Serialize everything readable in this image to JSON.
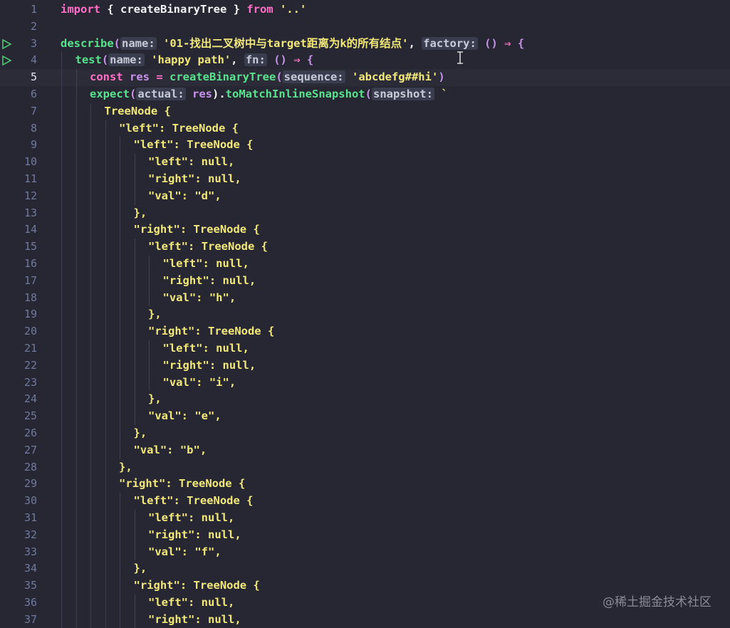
{
  "editor": {
    "language": "typescript",
    "current_line": 5,
    "lines": [
      {
        "n": "1",
        "indent": 0,
        "tokens": [
          {
            "t": "import",
            "c": "t-pink"
          },
          {
            "t": " { ",
            "c": "t-white"
          },
          {
            "t": "createBinaryTree",
            "c": "t-white"
          },
          {
            "t": " } ",
            "c": "t-white"
          },
          {
            "t": "from",
            "c": "t-pink"
          },
          {
            "t": " '..'",
            "c": "t-yellow"
          }
        ]
      },
      {
        "n": "2",
        "indent": 0,
        "tokens": []
      },
      {
        "n": "3",
        "indent": 0,
        "run": true,
        "tokens": [
          {
            "t": "describe",
            "c": "t-green"
          },
          {
            "t": "(",
            "c": "t-paren"
          },
          {
            "t": "name:",
            "c": "hint"
          },
          {
            "t": " '01-找出二叉树中与target距离为k的所有结点'",
            "c": "t-yellow"
          },
          {
            "t": ", ",
            "c": "t-white"
          },
          {
            "t": "factory:",
            "c": "hint"
          },
          {
            "t": " ",
            "c": "t-white"
          },
          {
            "t": "()",
            "c": "t-paren"
          },
          {
            "t": " ⇒ ",
            "c": "t-arrow"
          },
          {
            "t": "{",
            "c": "t-brace2"
          }
        ]
      },
      {
        "n": "4",
        "indent": 1,
        "run": true,
        "tokens": [
          {
            "t": "test",
            "c": "t-green"
          },
          {
            "t": "(",
            "c": "t-paren"
          },
          {
            "t": "name:",
            "c": "hint"
          },
          {
            "t": " 'happy path'",
            "c": "t-yellow"
          },
          {
            "t": ", ",
            "c": "t-white"
          },
          {
            "t": "fn:",
            "c": "hint"
          },
          {
            "t": " ",
            "c": "t-white"
          },
          {
            "t": "()",
            "c": "t-paren"
          },
          {
            "t": " ⇒ ",
            "c": "t-arrow"
          },
          {
            "t": "{",
            "c": "t-brace2"
          }
        ]
      },
      {
        "n": "5",
        "indent": 2,
        "tokens": [
          {
            "t": "const",
            "c": "t-pink"
          },
          {
            "t": " res",
            "c": "t-purple"
          },
          {
            "t": " = ",
            "c": "t-pink"
          },
          {
            "t": "createBinaryTree",
            "c": "t-green"
          },
          {
            "t": "(",
            "c": "t-paren"
          },
          {
            "t": "sequence:",
            "c": "hint"
          },
          {
            "t": " 'abcdefg##hi'",
            "c": "t-yellow"
          },
          {
            "t": ")",
            "c": "t-paren"
          }
        ]
      },
      {
        "n": "6",
        "indent": 2,
        "tokens": [
          {
            "t": "expect",
            "c": "t-green"
          },
          {
            "t": "(",
            "c": "t-paren"
          },
          {
            "t": "actual:",
            "c": "hint"
          },
          {
            "t": " res",
            "c": "t-purple"
          },
          {
            "t": ").",
            "c": "t-white"
          },
          {
            "t": "toMatchInlineSnapshot",
            "c": "t-green"
          },
          {
            "t": "(",
            "c": "t-paren"
          },
          {
            "t": "snapshot:",
            "c": "hint"
          },
          {
            "t": " `",
            "c": "t-yellow"
          }
        ]
      },
      {
        "n": "7",
        "indent": 3,
        "tokens": [
          {
            "t": "TreeNode {",
            "c": "t-yellow"
          }
        ]
      },
      {
        "n": "8",
        "indent": 4,
        "tokens": [
          {
            "t": "\"left\": TreeNode {",
            "c": "t-yellow"
          }
        ]
      },
      {
        "n": "9",
        "indent": 5,
        "tokens": [
          {
            "t": "\"left\": TreeNode {",
            "c": "t-yellow"
          }
        ]
      },
      {
        "n": "10",
        "indent": 6,
        "tokens": [
          {
            "t": "\"left\": null,",
            "c": "t-yellow"
          }
        ]
      },
      {
        "n": "11",
        "indent": 6,
        "tokens": [
          {
            "t": "\"right\": null,",
            "c": "t-yellow"
          }
        ]
      },
      {
        "n": "12",
        "indent": 6,
        "tokens": [
          {
            "t": "\"val\": \"d\",",
            "c": "t-yellow"
          }
        ]
      },
      {
        "n": "13",
        "indent": 5,
        "tokens": [
          {
            "t": "},",
            "c": "t-yellow"
          }
        ]
      },
      {
        "n": "14",
        "indent": 5,
        "tokens": [
          {
            "t": "\"right\": TreeNode {",
            "c": "t-yellow"
          }
        ]
      },
      {
        "n": "15",
        "indent": 6,
        "tokens": [
          {
            "t": "\"left\": TreeNode {",
            "c": "t-yellow"
          }
        ]
      },
      {
        "n": "16",
        "indent": 7,
        "tokens": [
          {
            "t": "\"left\": null,",
            "c": "t-yellow"
          }
        ]
      },
      {
        "n": "17",
        "indent": 7,
        "tokens": [
          {
            "t": "\"right\": null,",
            "c": "t-yellow"
          }
        ]
      },
      {
        "n": "18",
        "indent": 7,
        "tokens": [
          {
            "t": "\"val\": \"h\",",
            "c": "t-yellow"
          }
        ]
      },
      {
        "n": "19",
        "indent": 6,
        "tokens": [
          {
            "t": "},",
            "c": "t-yellow"
          }
        ]
      },
      {
        "n": "20",
        "indent": 6,
        "tokens": [
          {
            "t": "\"right\": TreeNode {",
            "c": "t-yellow"
          }
        ]
      },
      {
        "n": "21",
        "indent": 7,
        "tokens": [
          {
            "t": "\"left\": null,",
            "c": "t-yellow"
          }
        ]
      },
      {
        "n": "22",
        "indent": 7,
        "tokens": [
          {
            "t": "\"right\": null,",
            "c": "t-yellow"
          }
        ]
      },
      {
        "n": "23",
        "indent": 7,
        "tokens": [
          {
            "t": "\"val\": \"i\",",
            "c": "t-yellow"
          }
        ]
      },
      {
        "n": "24",
        "indent": 6,
        "tokens": [
          {
            "t": "},",
            "c": "t-yellow"
          }
        ]
      },
      {
        "n": "25",
        "indent": 6,
        "tokens": [
          {
            "t": "\"val\": \"e\",",
            "c": "t-yellow"
          }
        ]
      },
      {
        "n": "26",
        "indent": 5,
        "tokens": [
          {
            "t": "},",
            "c": "t-yellow"
          }
        ]
      },
      {
        "n": "27",
        "indent": 5,
        "tokens": [
          {
            "t": "\"val\": \"b\",",
            "c": "t-yellow"
          }
        ]
      },
      {
        "n": "28",
        "indent": 4,
        "tokens": [
          {
            "t": "},",
            "c": "t-yellow"
          }
        ]
      },
      {
        "n": "29",
        "indent": 4,
        "tokens": [
          {
            "t": "\"right\": TreeNode {",
            "c": "t-yellow"
          }
        ]
      },
      {
        "n": "30",
        "indent": 5,
        "tokens": [
          {
            "t": "\"left\": TreeNode {",
            "c": "t-yellow"
          }
        ]
      },
      {
        "n": "31",
        "indent": 6,
        "tokens": [
          {
            "t": "\"left\": null,",
            "c": "t-yellow"
          }
        ]
      },
      {
        "n": "32",
        "indent": 6,
        "tokens": [
          {
            "t": "\"right\": null,",
            "c": "t-yellow"
          }
        ]
      },
      {
        "n": "33",
        "indent": 6,
        "tokens": [
          {
            "t": "\"val\": \"f\",",
            "c": "t-yellow"
          }
        ]
      },
      {
        "n": "34",
        "indent": 5,
        "tokens": [
          {
            "t": "},",
            "c": "t-yellow"
          }
        ]
      },
      {
        "n": "35",
        "indent": 5,
        "tokens": [
          {
            "t": "\"right\": TreeNode {",
            "c": "t-yellow"
          }
        ]
      },
      {
        "n": "36",
        "indent": 6,
        "tokens": [
          {
            "t": "\"left\": null,",
            "c": "t-yellow"
          }
        ]
      },
      {
        "n": "37",
        "indent": 6,
        "tokens": [
          {
            "t": "\"right\": null,",
            "c": "t-yellow"
          }
        ]
      }
    ]
  },
  "watermark": "@稀土掘金技术社区",
  "colors": {
    "background": "#272734",
    "keyword": "#ff6ec7",
    "function": "#58e38c",
    "string": "#f2e87a",
    "variable": "#c792ea",
    "line_number": "#6f7a9d",
    "run_icon": "#4ec36e"
  }
}
